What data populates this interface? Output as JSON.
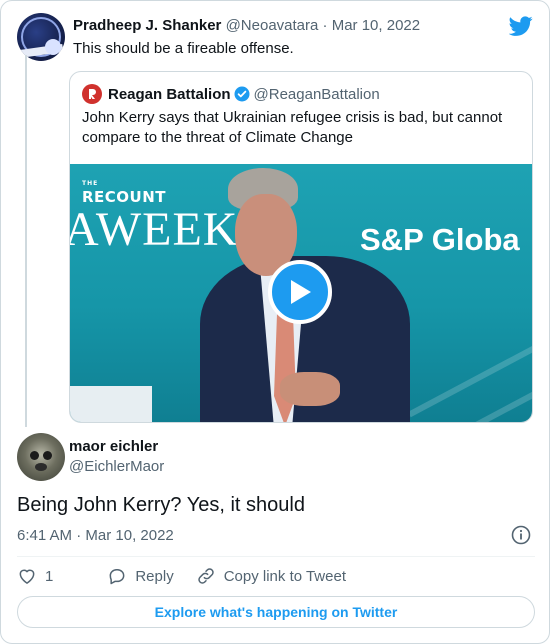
{
  "colors": {
    "accent": "#1d9bf0",
    "muted": "#536471",
    "border": "#cfd9de"
  },
  "parent_tweet": {
    "author_name": "Pradheep J. Shanker",
    "author_handle": "@Neoavatara",
    "separator": "·",
    "date": "Mar 10, 2022",
    "text": "This should be a fireable offense.",
    "brand_icon": "twitter-bird-icon"
  },
  "quoted_tweet": {
    "author_name": "Reagan Battalion",
    "author_handle": "@ReaganBattalion",
    "verified": true,
    "text": "John Kerry says that Ukrainian refugee crisis is bad, but cannot compare to the threat of Climate Change",
    "video": {
      "overlay_small": "THE",
      "overlay_brand": "RECOUNT",
      "backdrop_left": "AWEEK",
      "backdrop_right": "S&P Globa",
      "play_icon": "play-icon"
    }
  },
  "reply": {
    "author_name": "maor eichler",
    "author_handle": "@EichlerMaor",
    "text": "Being John Kerry? Yes, it should",
    "time": "6:41 AM",
    "separator": "·",
    "date": "Mar 10, 2022"
  },
  "actions": {
    "like_count": "1",
    "reply_label": "Reply",
    "copy_label": "Copy link to Tweet"
  },
  "explore_label": "Explore what's happening on Twitter"
}
